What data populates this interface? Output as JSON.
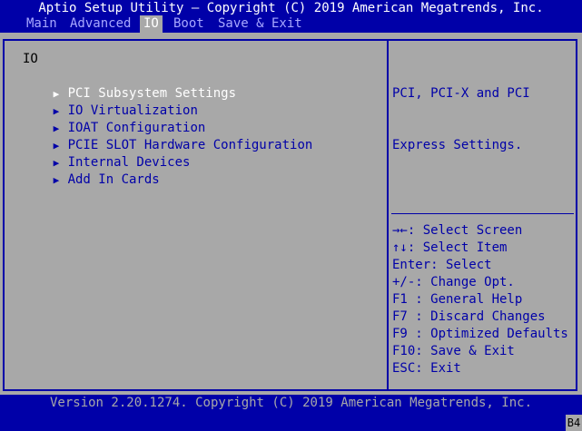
{
  "app": {
    "title": "Aptio Setup Utility – Copyright (C) 2019 American Megatrends, Inc."
  },
  "tabs": [
    {
      "label": "Main"
    },
    {
      "label": "Advanced"
    },
    {
      "label": "IO"
    },
    {
      "label": "Boot"
    },
    {
      "label": "Save & Exit"
    }
  ],
  "active_tab": "IO",
  "left_pane": {
    "heading": "IO",
    "arrow_icon": "triangle-right-icon",
    "items": [
      {
        "label": "PCI Subsystem Settings"
      },
      {
        "label": "IO Virtualization"
      },
      {
        "label": "IOAT Configuration"
      },
      {
        "label": "PCIE SLOT Hardware Configuration"
      },
      {
        "label": "Internal Devices"
      },
      {
        "label": "Add In Cards"
      }
    ],
    "selected_index": 0
  },
  "help": {
    "line1": "PCI, PCI-X and PCI",
    "line2": "Express Settings."
  },
  "keys": [
    {
      "text": "→←: Select Screen"
    },
    {
      "text": "↑↓: Select Item"
    },
    {
      "text": "Enter: Select"
    },
    {
      "text": "+/-: Change Opt."
    },
    {
      "text": "F1 : General Help"
    },
    {
      "text": "F7 : Discard Changes"
    },
    {
      "text": "F9 : Optimized Defaults"
    },
    {
      "text": "F10: Save & Exit"
    },
    {
      "text": "ESC: Exit"
    }
  ],
  "footer": {
    "version": "Version 2.20.1274. Copyright (C) 2019 American Megatrends, Inc.",
    "post_code": "B4"
  },
  "colors": {
    "background_blue": "#0000a8",
    "panel_gray": "#a8a8a8",
    "highlight_white": "#ffffff"
  }
}
